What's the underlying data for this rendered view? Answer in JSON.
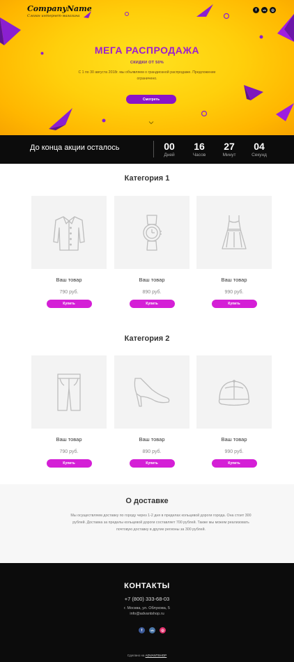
{
  "header": {
    "company_name": "CompanyName",
    "slogan": "Слоган интернет-магазина",
    "socials": [
      {
        "icon": "facebook-icon",
        "glyph": "f"
      },
      {
        "icon": "vk-icon",
        "glyph": "vk"
      },
      {
        "icon": "instagram-icon",
        "glyph": "◎"
      }
    ]
  },
  "hero": {
    "title": "МЕГА РАСПРОДАЖА",
    "subtitle": "СКИДКИ ОТ 50%",
    "description": "С 1 по 30 августа 2018г. мы объявляем о грандиозной распродаже. Предложение ограничено.",
    "button_label": "Смотреть",
    "accent_color": "#8a14c8",
    "scroll_icon": "chevron-down-icon"
  },
  "countdown": {
    "label": "До конца акции осталось",
    "units": [
      {
        "value": "00",
        "caption": "Дней"
      },
      {
        "value": "16",
        "caption": "Часов"
      },
      {
        "value": "27",
        "caption": "Минут"
      },
      {
        "value": "04",
        "caption": "Секунд"
      }
    ]
  },
  "categories": [
    {
      "title": "Категория 1",
      "products": [
        {
          "name": "Ваш товар",
          "price": "790 руб.",
          "button": "Купить",
          "icon": "shirt-icon"
        },
        {
          "name": "Ваш товар",
          "price": "890 руб.",
          "button": "Купить",
          "icon": "watch-icon"
        },
        {
          "name": "Ваш товар",
          "price": "990 руб.",
          "button": "Купить",
          "icon": "dress-icon"
        }
      ]
    },
    {
      "title": "Категория 2",
      "products": [
        {
          "name": "Ваш товар",
          "price": "790 руб.",
          "button": "Купить",
          "icon": "shorts-icon"
        },
        {
          "name": "Ваш товар",
          "price": "890 руб.",
          "button": "Купить",
          "icon": "high-heel-icon"
        },
        {
          "name": "Ваш товар",
          "price": "990 руб.",
          "button": "Купить",
          "icon": "cap-icon"
        }
      ]
    }
  ],
  "delivery": {
    "title": "О доставке",
    "text": "Мы осуществляем доставку по городу через 1-2 дня в пределах кольцевой дороги города. Она стоит 300 рублей. Доставка за пределы кольцевой дороги составляет 700 рублей. Также мы можем реализовать почтовую доставку в другие регионы за 300 рублей."
  },
  "footer": {
    "title": "КОНТАКТЫ",
    "phone": "+7 (800) 333-68-03",
    "address": "г. Москва, ул. Облукова, 5",
    "email": "info@advantshop.ru",
    "socials": [
      {
        "icon": "facebook-icon",
        "glyph": "f",
        "color": "#3b5998"
      },
      {
        "icon": "vk-icon",
        "glyph": "vk",
        "color": "#4a76a8"
      },
      {
        "icon": "instagram-icon",
        "glyph": "◎",
        "color": "#e1306c"
      }
    ],
    "made_prefix": "Сделано на",
    "made_link": "ADVANTSHOP"
  },
  "colors": {
    "buy_button": "#d41fd6",
    "hero_yellow": "#ffcf0b",
    "dark": "#0c0c0c"
  }
}
